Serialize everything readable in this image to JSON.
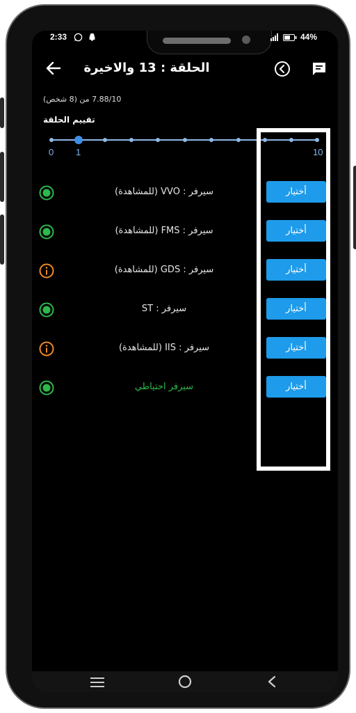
{
  "status_bar": {
    "time": "2:33",
    "battery": "44%"
  },
  "header": {
    "title": "الحلقة : 13 والاخيرة",
    "back_icon": "arrow-left-icon",
    "prev_icon": "chevron-circle-left-icon",
    "comments_icon": "comment-icon"
  },
  "rating": {
    "count_text": "7.88/10 من (8 شخص)",
    "label": "تقييم الحلقة",
    "min_label": "0",
    "current_label": "1",
    "max_label": "10",
    "value": 1,
    "max": 10
  },
  "servers": [
    {
      "name": "سيرفر : VVO (للمشاهدة)",
      "status": "online",
      "button": "أختيار"
    },
    {
      "name": "سيرفر : FMS (للمشاهدة)",
      "status": "online",
      "button": "أختيار"
    },
    {
      "name": "سيرفر : GDS (للمشاهدة)",
      "status": "info",
      "button": "أختيار"
    },
    {
      "name": "سيرفر : ST",
      "status": "online",
      "button": "أختيار"
    },
    {
      "name": "سيرفر : IIS (للمشاهدة)",
      "status": "info",
      "button": "أختيار"
    },
    {
      "name": "سيرفر احتياطي",
      "status": "online",
      "button": "أختيار",
      "highlight": true
    }
  ],
  "colors": {
    "online": "#2fb84a",
    "info": "#f08a24",
    "button": "#1e9bea",
    "backup_text": "#2fb84a"
  },
  "nav": {
    "menu_icon": "menu-icon",
    "home_icon": "home-circle-icon",
    "back_icon": "back-chevron-icon"
  }
}
